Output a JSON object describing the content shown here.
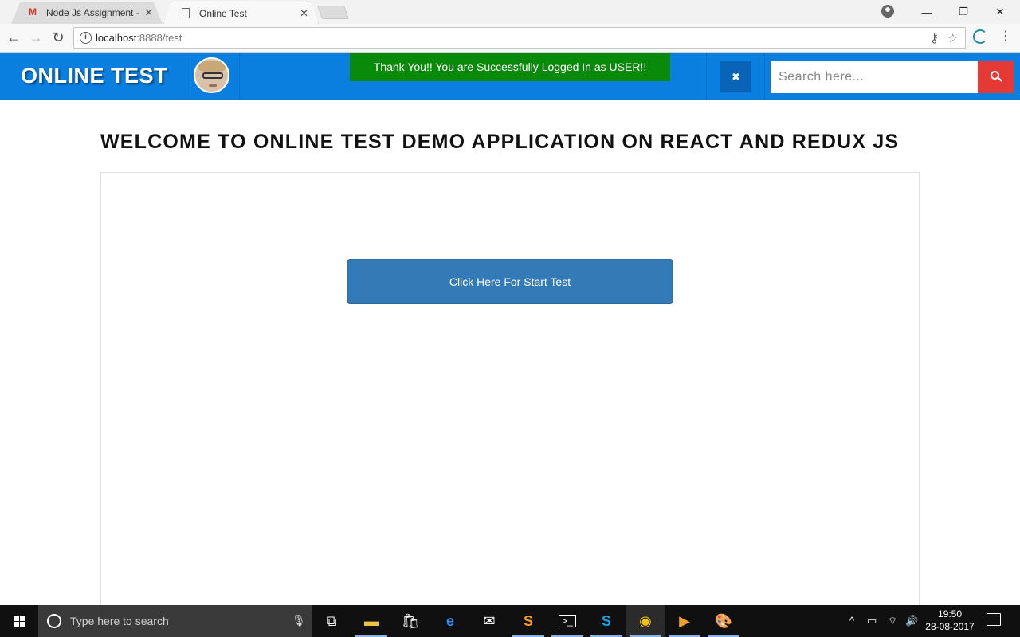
{
  "browser": {
    "tabs": [
      {
        "title": "Node Js Assignment - m",
        "icon": "gmail-icon"
      },
      {
        "title": "Online Test",
        "icon": "page-icon"
      }
    ],
    "address": {
      "host": "localhost",
      "rest": ":8888/test"
    },
    "window_controls": {
      "minimize": "—",
      "maximize": "❐",
      "close": "✕"
    }
  },
  "header": {
    "brand": "ONLINE TEST",
    "toast": "Thank You!! You are Successfully Logged In as USER!!",
    "fullscreen_glyph": "✖",
    "search_placeholder": "Search here..."
  },
  "main": {
    "title": "WELCOME TO ONLINE TEST DEMO APPLICATION ON REACT AND REDUX JS",
    "start_button": "Click Here For Start Test"
  },
  "taskbar": {
    "search_placeholder": "Type here to search",
    "time": "19:50",
    "date": "28-08-2017",
    "apps": [
      "task-view",
      "file-explorer",
      "store",
      "edge",
      "mail",
      "sublime-text",
      "terminal",
      "skype",
      "chrome",
      "media-player",
      "paint"
    ]
  },
  "colors": {
    "header": "#0a7fe0",
    "toast": "#0a8a0a",
    "search_button": "#e53935",
    "primary_button": "#337ab7"
  }
}
